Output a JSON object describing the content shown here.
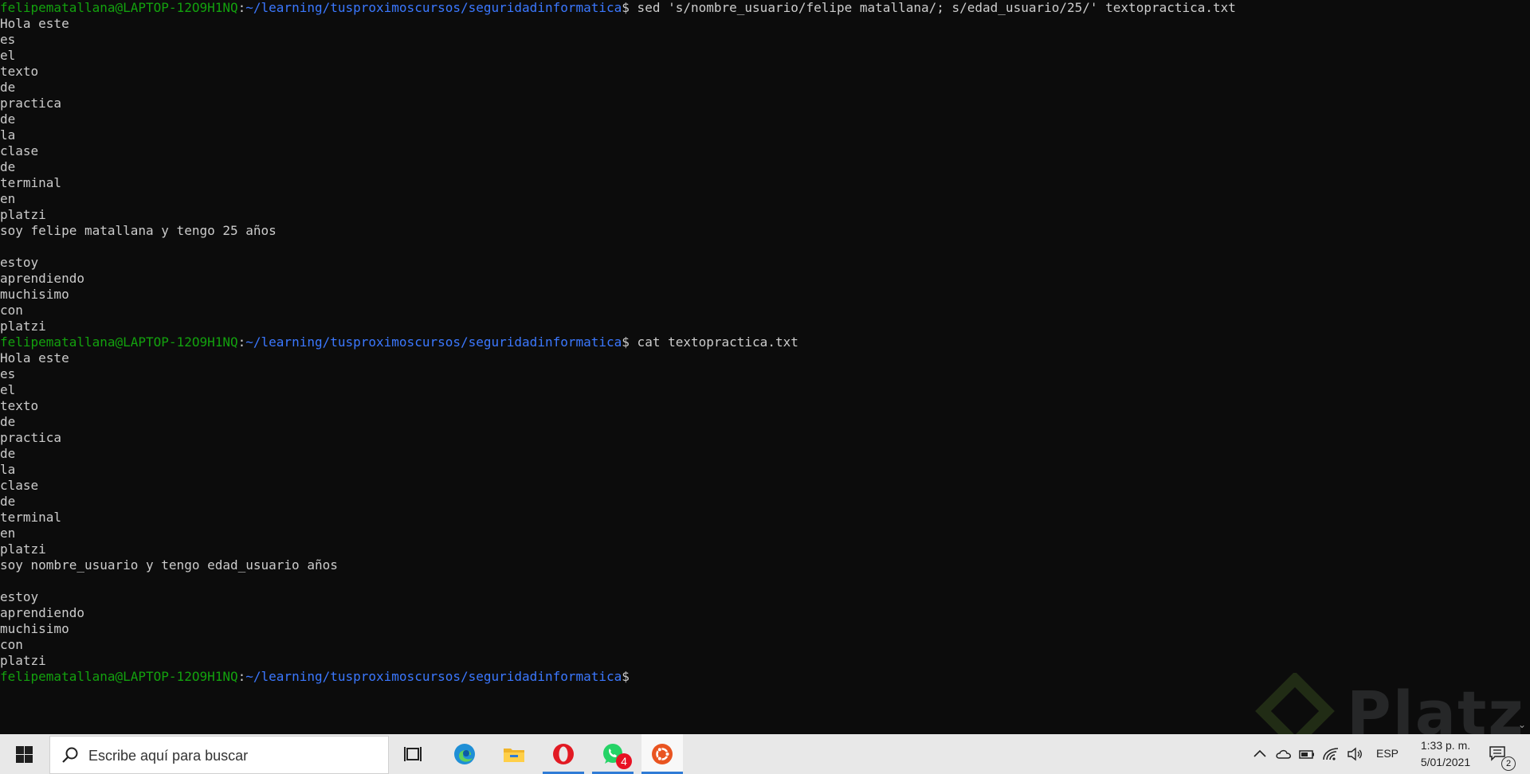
{
  "terminal": {
    "prompt": {
      "user_host": "felipematallana@LAPTOP-12O9H1NQ",
      "separator": ":",
      "path": "~/learning/tusproximoscursos/seguridadinformatica",
      "symbol": "$"
    },
    "command1": " sed 's/nombre_usuario/felipe matallana/; s/edad_usuario/25/' textopractica.txt",
    "output1": [
      "Hola este",
      "es",
      "el",
      "texto",
      "de",
      "practica",
      "de",
      "la",
      "clase",
      "de",
      "terminal",
      "en",
      "platzi",
      "soy felipe matallana y tengo 25 años",
      "",
      "estoy",
      "aprendiendo",
      "muchisimo",
      "con",
      "platzi"
    ],
    "command2": " cat textopractica.txt",
    "output2": [
      "Hola este",
      "es",
      "el",
      "texto",
      "de",
      "practica",
      "de",
      "la",
      "clase",
      "de",
      "terminal",
      "en",
      "platzi",
      "soy nombre_usuario y tengo edad_usuario años",
      "",
      "estoy",
      "aprendiendo",
      "muchisimo",
      "con",
      "platzi"
    ]
  },
  "watermark": {
    "text": "Platzi"
  },
  "taskbar": {
    "search_placeholder": "Escribe aquí para buscar",
    "apps": [
      {
        "name": "task-view",
        "icon": "task-view-icon"
      },
      {
        "name": "edge",
        "icon": "edge-icon"
      },
      {
        "name": "file-explorer",
        "icon": "folder-icon"
      },
      {
        "name": "opera",
        "icon": "opera-icon"
      },
      {
        "name": "whatsapp",
        "icon": "whatsapp-icon",
        "badge": "4"
      },
      {
        "name": "ubuntu",
        "icon": "ubuntu-icon"
      }
    ],
    "tray": {
      "language": "ESP",
      "time": "1:33 p. m.",
      "date": "5/01/2021",
      "notifications_count": "2"
    }
  },
  "colors": {
    "terminal_bg": "#0c0c0c",
    "terminal_text": "#cccccc",
    "prompt_user": "#13a10e",
    "prompt_path": "#3b78ff",
    "taskbar_bg": "#e8e8e8"
  }
}
